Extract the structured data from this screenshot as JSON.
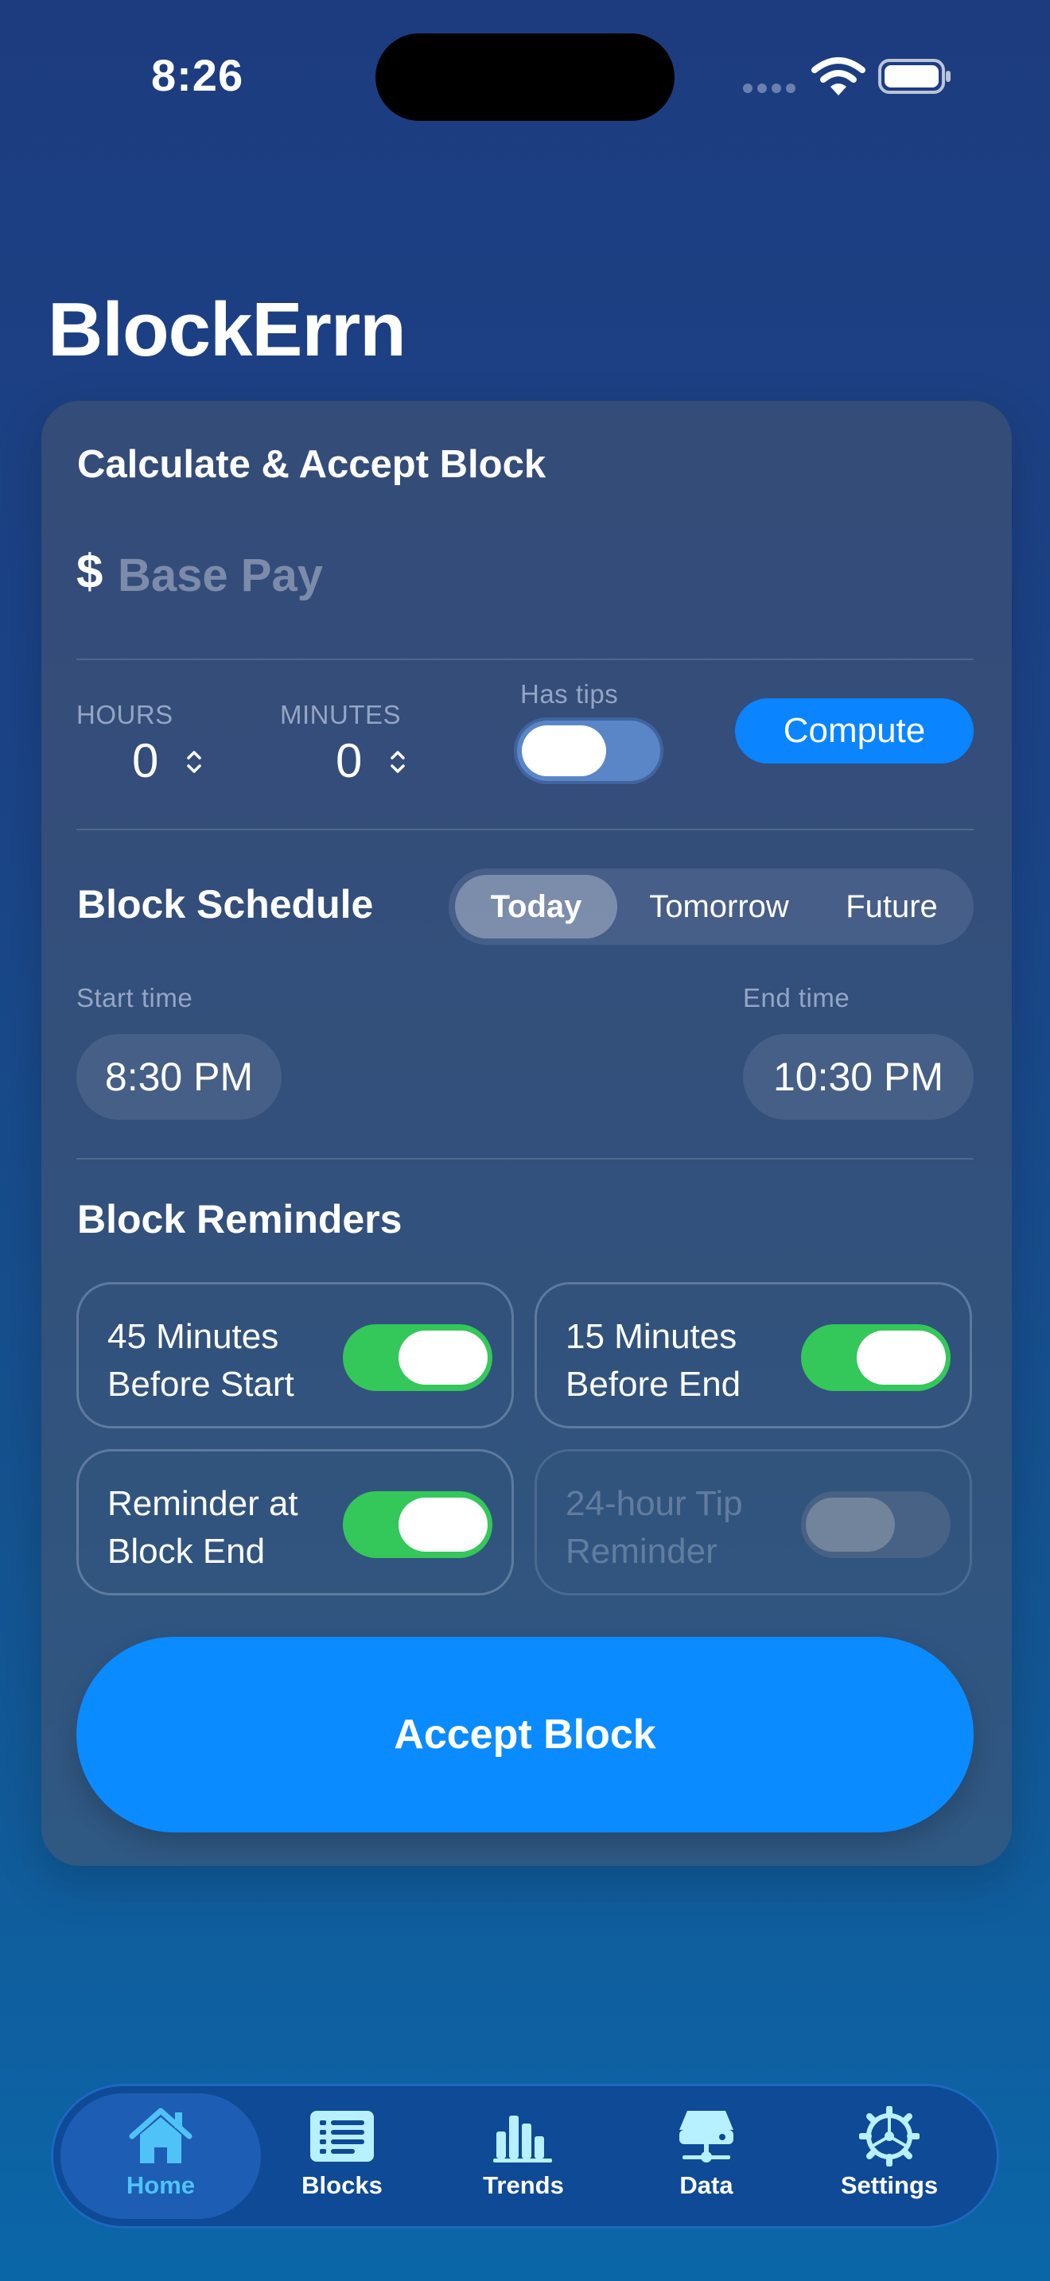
{
  "status_bar": {
    "time": "8:26"
  },
  "app": {
    "title": "BlockErrn"
  },
  "calculate": {
    "title": "Calculate & Accept Block",
    "currency_symbol": "$",
    "base_pay_placeholder": "Base Pay",
    "hours_label": "HOURS",
    "hours_value": "0",
    "minutes_label": "MINUTES",
    "minutes_value": "0",
    "has_tips_label": "Has tips",
    "has_tips_on": true,
    "compute_label": "Compute"
  },
  "schedule": {
    "title": "Block Schedule",
    "segments": [
      "Today",
      "Tomorrow",
      "Future"
    ],
    "selected_segment": "Today",
    "start_label": "Start time",
    "start_value": "8:30 PM",
    "end_label": "End time",
    "end_value": "10:30 PM"
  },
  "reminders": {
    "title": "Block Reminders",
    "items": [
      {
        "label": "45 Minutes Before Start",
        "on": true,
        "enabled": true
      },
      {
        "label": "15 Minutes Before End",
        "on": true,
        "enabled": true
      },
      {
        "label": "Reminder at Block End",
        "on": true,
        "enabled": true
      },
      {
        "label": "24-hour Tip Reminder",
        "on": false,
        "enabled": false
      }
    ]
  },
  "accept_button": "Accept Block",
  "tabbar": {
    "active": "Home",
    "items": [
      {
        "label": "Home",
        "icon": "house-icon"
      },
      {
        "label": "Blocks",
        "icon": "list-icon"
      },
      {
        "label": "Trends",
        "icon": "chart-bar-icon"
      },
      {
        "label": "Data",
        "icon": "server-icon"
      },
      {
        "label": "Settings",
        "icon": "gear-icon"
      }
    ]
  },
  "colors": {
    "accent": "#0A84FF",
    "toggle_on": "#34C759",
    "active_tab": "#4FC3F7"
  }
}
